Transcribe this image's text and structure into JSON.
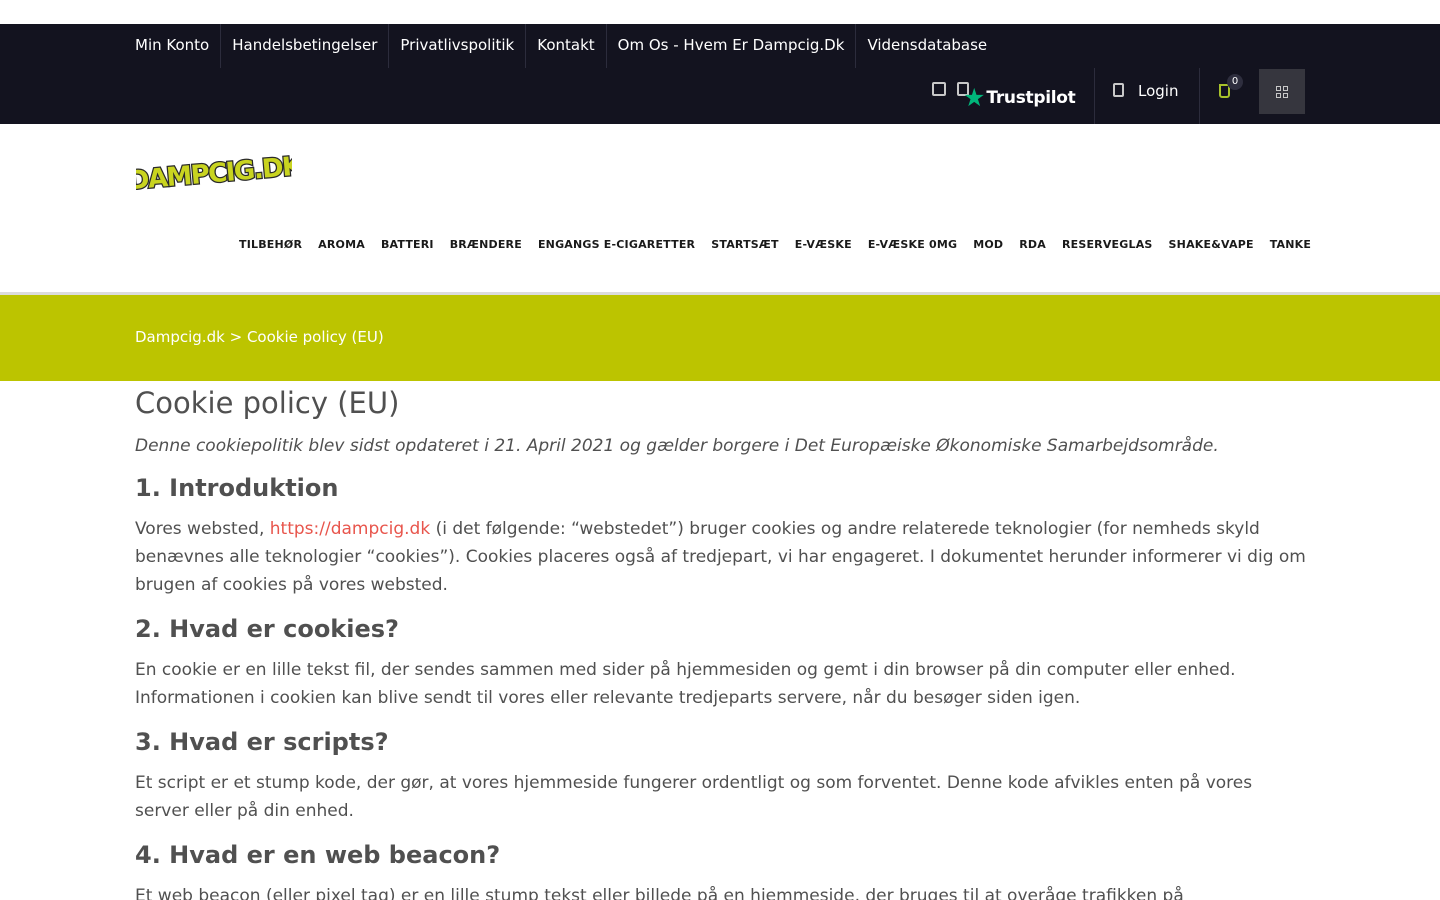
{
  "top_links": [
    "Min Konto",
    "Handelsbetingelser",
    "Privatlivspolitik",
    "Kontakt",
    "Om Os - Hvem Er Dampcig.Dk",
    "Vidensdatabase"
  ],
  "utility": {
    "trustpilot_label": "Trustpilot",
    "login_label": "Login",
    "cart_count": "0",
    "icons": [
      "heart-icon",
      "compare-icon",
      "trustpilot-star-icon",
      "user-icon",
      "cart-icon",
      "grid-icon"
    ]
  },
  "logo_text": "DAMPCIG.DK",
  "nav": [
    "TILBEHØR",
    "AROMA",
    "BATTERI",
    "BRÆNDERE",
    "ENGANGS E-CIGARETTER",
    "STARTSÆT",
    "E-VÆSKE",
    "E-VÆSKE 0MG",
    "MOD",
    "RDA",
    "RESERVEGLAS",
    "SHAKE&VAPE",
    "TANKE"
  ],
  "breadcrumb": {
    "home": "Dampcig.dk",
    "separator": ">",
    "current": "Cookie policy (EU)"
  },
  "page": {
    "title": "Cookie policy (EU)",
    "lead": "Denne cookiepolitik blev sidst opdateret i 21. April  2021 og gælder borgere i Det Europæiske Økonomiske Samarbejdsområde.",
    "sections": [
      {
        "heading": "1. Introduktion",
        "text_before": "Vores websted, ",
        "link": "https://dampcig.dk",
        "text_after": " (i det følgende: “webstedet”) bruger cookies og andre relaterede teknologier (for nemheds skyld benævnes alle teknologier “cookies”). Cookies placeres også af tredjepart, vi har engageret. I dokumentet herunder informerer vi dig om brugen af cookies på vores websted."
      },
      {
        "heading": "2. Hvad er cookies?",
        "text": "En cookie er en lille tekst fil, der sendes sammen med sider på hjemmesiden og gemt i din browser på din computer eller enhed. Informationen i cookien kan blive sendt til vores eller relevante tredjeparts servere, når du besøger siden igen."
      },
      {
        "heading": "3. Hvad er scripts?",
        "text": "Et script er et stump kode, der gør, at vores hjemmeside fungerer ordentligt og som forventet. Denne kode afvikles enten på vores server eller på din enhed."
      },
      {
        "heading": "4. Hvad er en web beacon?",
        "text": "Et web beacon (eller pixel tag) er en lille stump tekst eller billede på en hjemmeside, der bruges til at overåge trafikken på"
      }
    ]
  },
  "colors": {
    "topbar": "#13131f",
    "banner": "#bcc400",
    "link": "#e8554c",
    "trustpilot": "#00b67a",
    "cart": "#a8c22b"
  }
}
